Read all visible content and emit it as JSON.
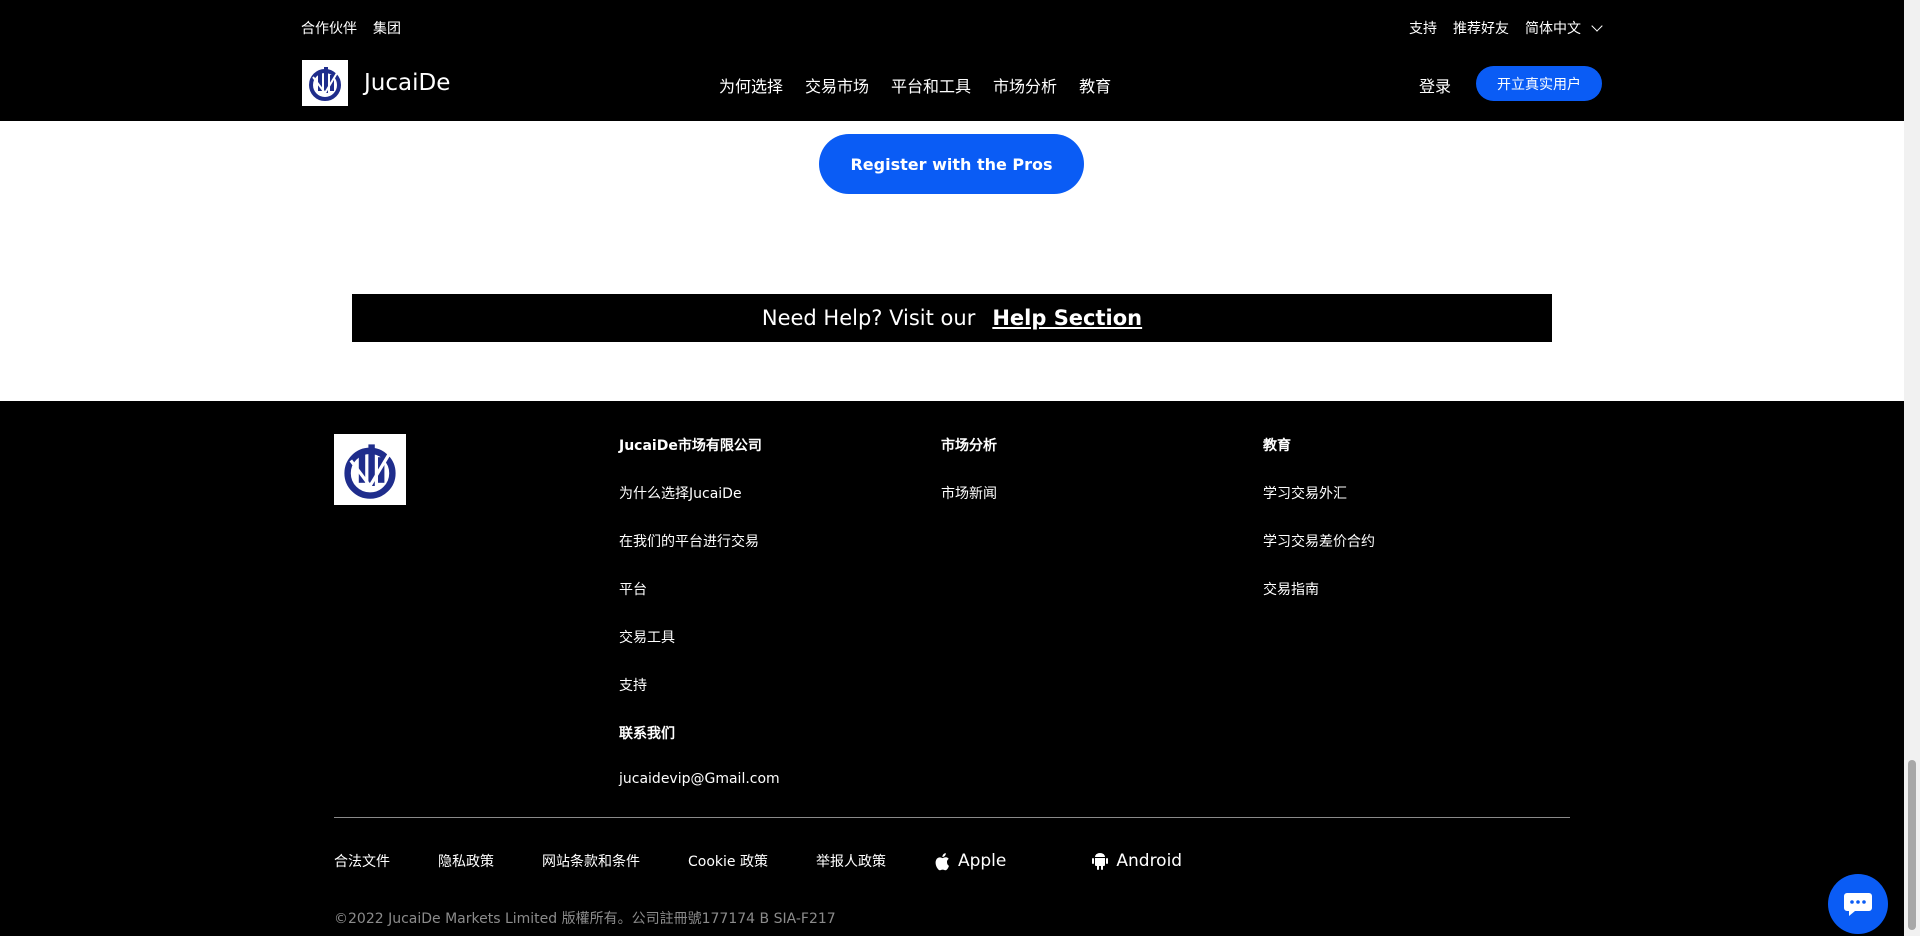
{
  "header": {
    "top_left": [
      "合作伙伴",
      "集团"
    ],
    "top_right": {
      "support": "支持",
      "refer": "推荐好友",
      "language": "简体中文"
    },
    "brand": "JucaiDe",
    "nav": [
      "为何选择",
      "交易市场",
      "平台和工具",
      "市场分析",
      "教育"
    ],
    "login": "登录",
    "open_account": "开立真实用户"
  },
  "cta": {
    "register": "Register with the Pros"
  },
  "help": {
    "prefix": "Need Help? Visit our",
    "link": "Help Section"
  },
  "footer": {
    "col1": {
      "head": "JucaiDe市场有限公司",
      "items": [
        "为什么选择JucaiDe",
        "在我们的平台进行交易",
        "平台",
        "交易工具",
        "支持"
      ],
      "contact_head": "联系我们",
      "email": "jucaidevip@Gmail.com"
    },
    "col2": {
      "head": "市场分析",
      "items": [
        "市场新闻"
      ]
    },
    "col3": {
      "head": "教育",
      "items": [
        "学习交易外汇",
        "学习交易差价合约",
        "交易指南"
      ]
    },
    "legal": [
      "合法文件",
      "隐私政策",
      "网站条款和条件",
      "Cookie 政策",
      "举报人政策"
    ],
    "apps": {
      "apple": "Apple",
      "android": "Android"
    },
    "copyright": "©2022 JucaiDe Markets Limited 版權所有。公司註冊號177174 B SIA-F217"
  },
  "colors": {
    "accent": "#0a5cf5",
    "header_bg": "#000000",
    "logo_blue": "#1f2d8c"
  },
  "icons": [
    "chevron-down-icon",
    "logo-icon",
    "apple-icon",
    "android-icon",
    "chat-icon"
  ]
}
